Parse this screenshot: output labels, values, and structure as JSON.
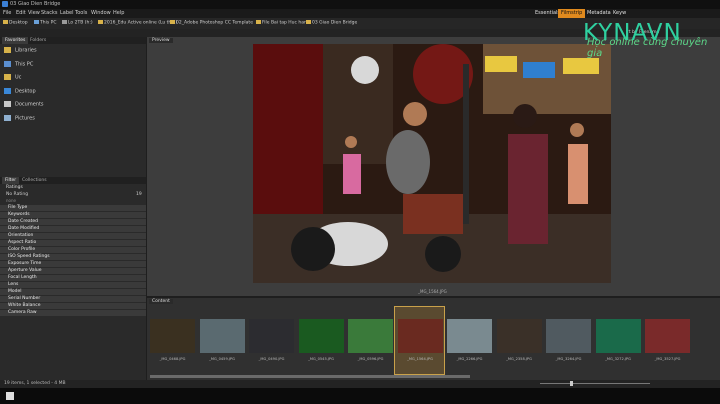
{
  "window": {
    "title": "03 Giao Dien Bridge"
  },
  "menu": {
    "items": [
      "File",
      "Edit",
      "View",
      "Stacks",
      "Label",
      "Tools",
      "Window",
      "Help"
    ]
  },
  "workspaces": {
    "essentials": "Essentials",
    "filmstrip": "Filmstrip",
    "metadata": "Metadata",
    "more": "Keyw"
  },
  "path": {
    "crumbs": [
      "Desktop",
      "This PC",
      "Lo 2TB (h:)",
      "2016_Edu Active online (Lu thin)",
      "02_Adobe Photoshop CC Template",
      "File Bai tap Huc hanh",
      "03 Giao Dien Bridge"
    ]
  },
  "sort": {
    "label": "rt by Filename"
  },
  "favorites": {
    "tab_favorites": "Favorites",
    "tab_folders": "Folders",
    "items": [
      {
        "label": "Libraries",
        "icon": "libraries-icon"
      },
      {
        "label": "This PC",
        "icon": "computer-icon"
      },
      {
        "label": "Uc",
        "icon": "folder-icon"
      },
      {
        "label": "Desktop",
        "icon": "desktop-icon"
      },
      {
        "label": "Documents",
        "icon": "documents-icon"
      },
      {
        "label": "Pictures",
        "icon": "pictures-icon"
      }
    ]
  },
  "filter": {
    "tab_filter": "Filter",
    "tab_collections": "Collections",
    "ratings": "Ratings",
    "no_rating": "No Rating",
    "no_rating_count": "19",
    "none_label": "none",
    "rows": [
      "File Type",
      "Keywords",
      "Date Created",
      "Date Modified",
      "Orientation",
      "Aspect Ratio",
      "Color Profile",
      "ISO Speed Ratings",
      "Exposure Time",
      "Aperture Value",
      "Focal Length",
      "Lens",
      "Model",
      "Serial Number",
      "White Balance",
      "Camera Raw"
    ]
  },
  "preview": {
    "tab": "Preview",
    "caption": "_MG_1564.JPG"
  },
  "content": {
    "tab": "Content",
    "thumbs": [
      "_MG_0468.JPG",
      "_MG_0459.JPG",
      "_MG_0490.JPG",
      "_MG_0545.JPG",
      "_MG_0596.JPG",
      "_MG_1564.JPG",
      "_MG_2266.JPG",
      "_MG_2358.JPG",
      "_MG_3264.JPG",
      "_MG_3272.JPG",
      "_MG_3527.JPG"
    ]
  },
  "status": {
    "text": "19 items, 1 selected - 4 MB"
  },
  "watermark": {
    "brand": "KYNAVN",
    "slogan": "Học online cùng chuyên gia"
  },
  "colors": {
    "accent": "#e08a1e",
    "brand": "#2fd0a0"
  }
}
